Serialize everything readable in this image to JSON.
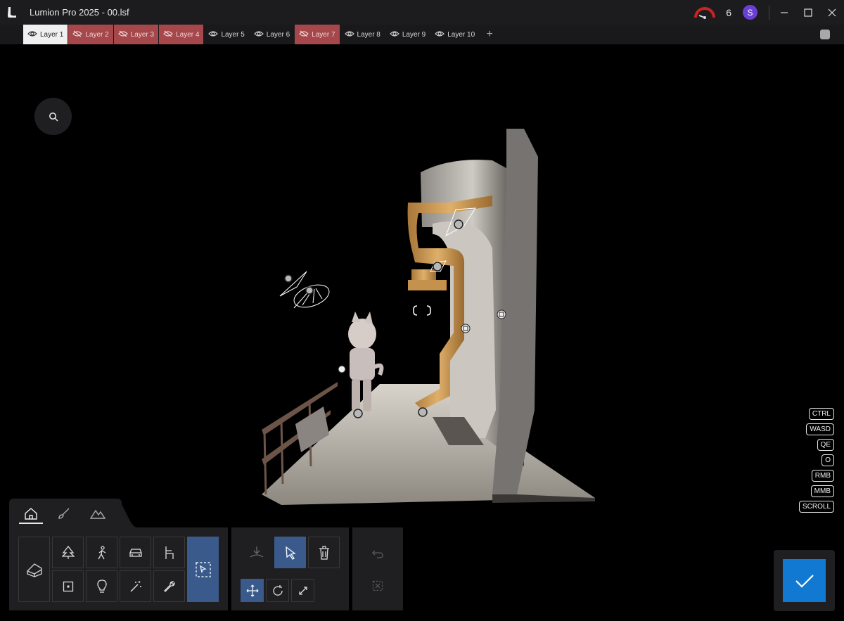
{
  "window": {
    "title": "Lumion Pro 2025 - 00.lsf",
    "counter": "6",
    "user_initial": "S",
    "colors": {
      "accent_blue": "#1279d3",
      "selected_tool": "#3b5a8c",
      "hidden_layer": "#a5474b",
      "avatar": "#6a3fd6"
    }
  },
  "layers": {
    "items": [
      {
        "label": "Layer 1",
        "state": "active"
      },
      {
        "label": "Layer 2",
        "state": "hidden"
      },
      {
        "label": "Layer 3",
        "state": "hidden"
      },
      {
        "label": "Layer 4",
        "state": "hidden"
      },
      {
        "label": "Layer 5",
        "state": "visible"
      },
      {
        "label": "Layer 6",
        "state": "visible"
      },
      {
        "label": "Layer 7",
        "state": "hidden"
      },
      {
        "label": "Layer 8",
        "state": "visible"
      },
      {
        "label": "Layer 9",
        "state": "visible"
      },
      {
        "label": "Layer 10",
        "state": "visible"
      }
    ],
    "add_symbol": "+"
  },
  "key_hints": [
    "CTRL",
    "WASD",
    "QE",
    "O",
    "RMB",
    "MMB",
    "SCROLL"
  ],
  "toolbar": {
    "tabs": [
      {
        "icon": "home-icon",
        "selected": true
      },
      {
        "icon": "brush-icon",
        "selected": false
      },
      {
        "icon": "landscape-icon",
        "selected": false
      }
    ],
    "categories": [
      {
        "icon": "tree-icon"
      },
      {
        "icon": "person-icon"
      },
      {
        "icon": "car-icon"
      },
      {
        "icon": "chair-icon"
      },
      {
        "icon": "dice-icon"
      },
      {
        "icon": "lightbulb-icon"
      },
      {
        "icon": "magic-wand-icon"
      },
      {
        "icon": "wrench-icon"
      }
    ],
    "tools": [
      "place-icon",
      "select-arrow-icon",
      "delete-icon",
      "move-icon",
      "rotate-icon",
      "scale-icon"
    ],
    "history": [
      "undo-icon",
      "clear-selection-icon"
    ],
    "confirm": "checkmark-icon"
  }
}
